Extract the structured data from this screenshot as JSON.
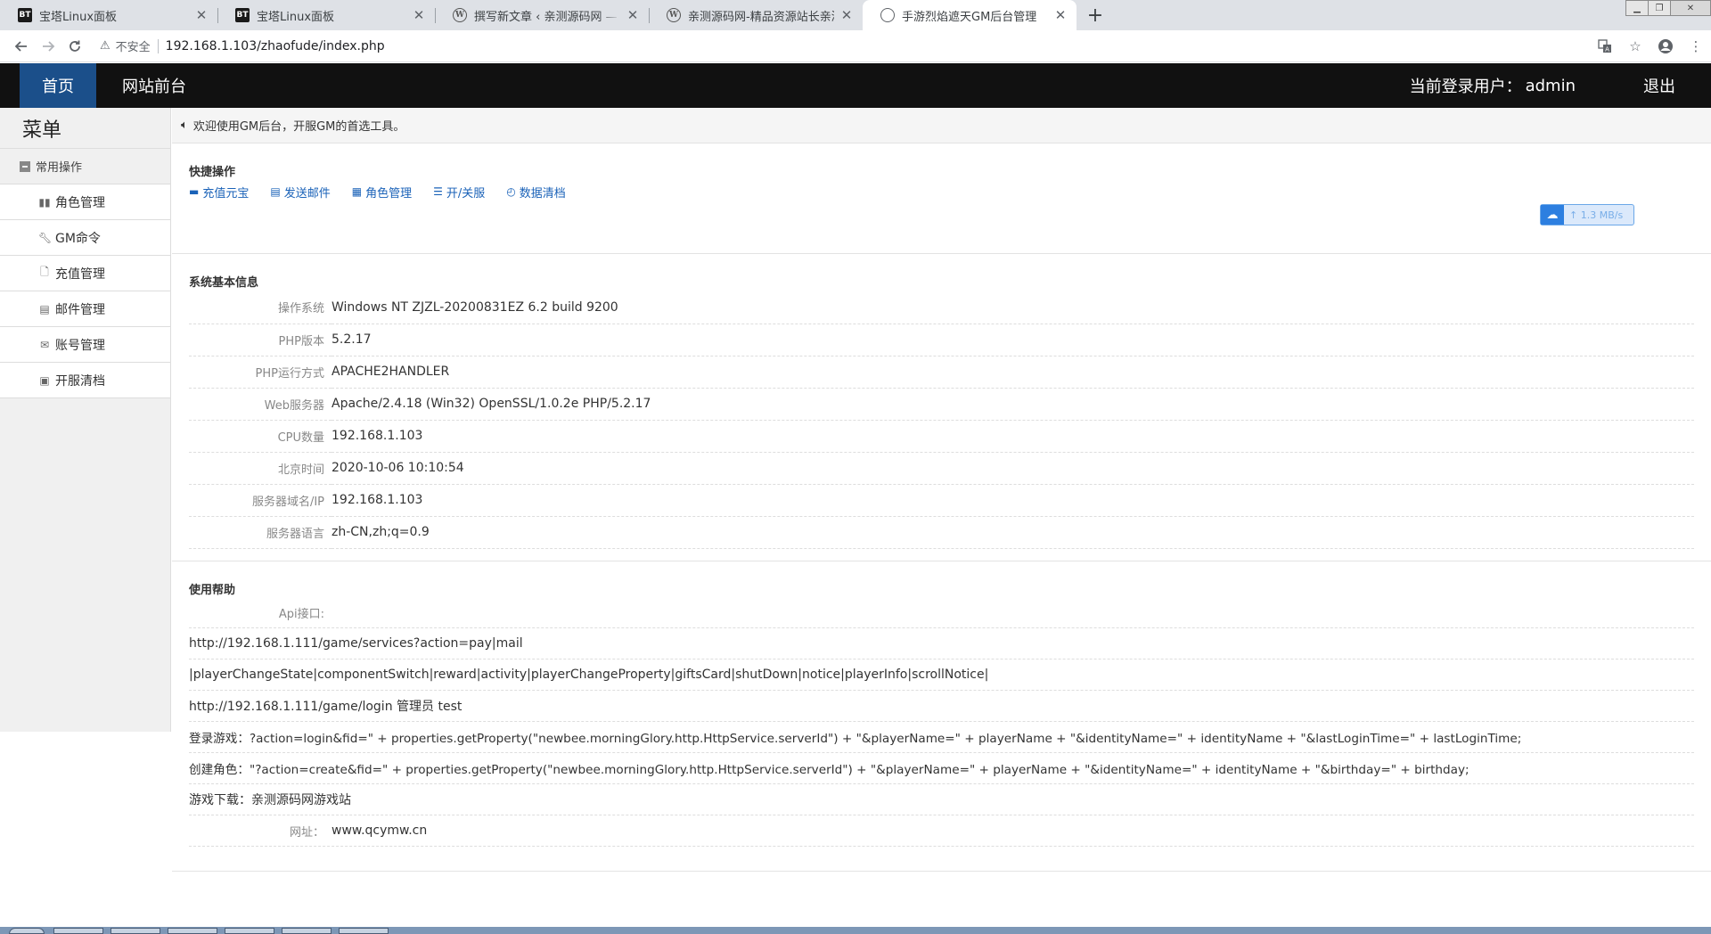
{
  "browser": {
    "tabs": [
      {
        "title": "宝塔Linux面板",
        "favicon": "BT"
      },
      {
        "title": "宝塔Linux面板",
        "favicon": "BT"
      },
      {
        "title": "撰写新文章 ‹ 亲测源码网 — WordPress",
        "favicon": "W"
      },
      {
        "title": "亲测源码网-精品资源站长亲测",
        "favicon": "W"
      },
      {
        "title": "手游烈焰遮天GM后台管理",
        "favicon": "globe"
      }
    ],
    "address": {
      "security_label": "不安全",
      "url": "192.168.1.103/zhaofude/index.php"
    }
  },
  "header": {
    "home": "首页",
    "front": "网站前台",
    "user_label": "当前登录用户：",
    "user_name": "admin",
    "logout": "退出"
  },
  "sidebar": {
    "title": "菜单",
    "group": "常用操作",
    "items": [
      {
        "label": "角色管理",
        "icon": "user-group-icon"
      },
      {
        "label": "GM命令",
        "icon": "wrench-icon"
      },
      {
        "label": "充值管理",
        "icon": "file-icon"
      },
      {
        "label": "邮件管理",
        "icon": "document-icon"
      },
      {
        "label": "账号管理",
        "icon": "envelope-icon"
      },
      {
        "label": "开服清档",
        "icon": "image-icon"
      }
    ]
  },
  "notice": "欢迎使用GM后台，开服GM的首选工具。",
  "quick": {
    "title": "快捷操作",
    "links": [
      {
        "label": "充值元宝",
        "icon": "card-icon"
      },
      {
        "label": "发送邮件",
        "icon": "list-icon"
      },
      {
        "label": "角色管理",
        "icon": "table-icon"
      },
      {
        "label": "开/关服",
        "icon": "menu-icon"
      },
      {
        "label": "数据清档",
        "icon": "dashboard-icon"
      }
    ]
  },
  "sysinfo": {
    "title": "系统基本信息",
    "rows": [
      {
        "k": "操作系统",
        "v": "Windows NT ZJZL-20200831EZ 6.2 build 9200"
      },
      {
        "k": "PHP版本",
        "v": "5.2.17"
      },
      {
        "k": "PHP运行方式",
        "v": "APACHE2HANDLER"
      },
      {
        "k": "Web服务器",
        "v": "Apache/2.4.18 (Win32) OpenSSL/1.0.2e PHP/5.2.17"
      },
      {
        "k": "CPU数量",
        "v": "192.168.1.103"
      },
      {
        "k": "北京时间",
        "v": "2020-10-06 10:10:54"
      },
      {
        "k": "服务器域名/IP",
        "v": "192.168.1.103"
      },
      {
        "k": "服务器语言",
        "v": "zh-CN,zh;q=0.9"
      }
    ]
  },
  "help": {
    "title": "使用帮助",
    "api_label": "Api接口:",
    "lines": [
      "http://192.168.1.111/game/services?action=pay|mail",
      "|playerChangeState|componentSwitch|reward|activity|playerChangeProperty|giftsCard|shutDown|notice|playerInfo|scrollNotice|",
      "http://192.168.1.111/game/login 管理员 test",
      "登录游戏：?action=login&fid=\" + properties.getProperty(\"newbee.morningGlory.http.HttpService.serverId\") + \"&playerName=\" + playerName + \"&identityName=\" + identityName + \"&lastLoginTime=\" + lastLoginTime;",
      "创建角色：\"?action=create&fid=\" + properties.getProperty(\"newbee.morningGlory.http.HttpService.serverId\") + \"&playerName=\" + playerName + \"&identityName=\" + identityName + \"&birthday=\" + birthday;",
      "游戏下载：亲测源码网游戏站"
    ],
    "site_label": "网址：",
    "site_value": "www.qcymw.cn"
  },
  "speed_widget": {
    "value": "1.3 MB/s"
  }
}
